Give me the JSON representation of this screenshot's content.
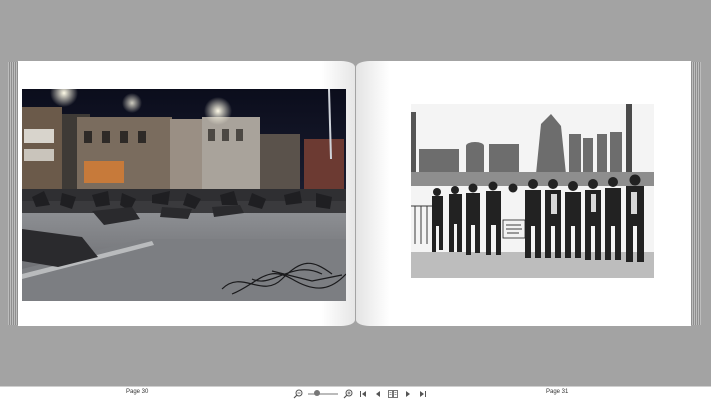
{
  "pages": {
    "left": {
      "label": "Page 30",
      "photo": "street-barricade-night-photo"
    },
    "right": {
      "label": "Page 31",
      "photo": "steelworkers-march-photo"
    }
  },
  "toolbar": {
    "zoom_level": 0.25,
    "icons": [
      "zoom-out-icon",
      "zoom-in-icon",
      "first-page-icon",
      "previous-page-icon",
      "double-page-view-icon",
      "next-page-icon",
      "last-page-icon"
    ]
  }
}
